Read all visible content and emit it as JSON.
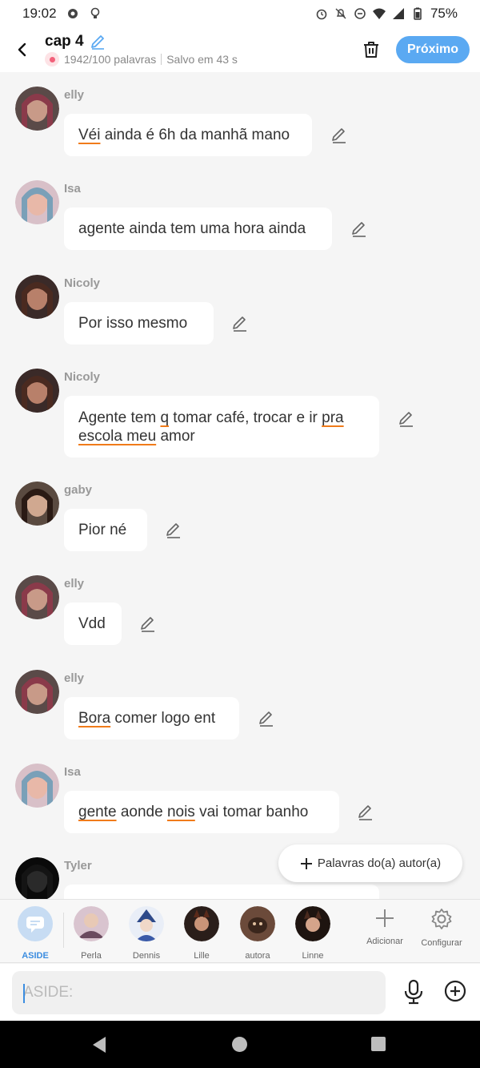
{
  "status": {
    "time": "19:02",
    "battery": "75%"
  },
  "header": {
    "title": "cap 4",
    "word_count": "1942/100 palavras",
    "saved": "Salvo em 43 s",
    "next_label": "Próximo"
  },
  "messages": [
    {
      "name": "elly",
      "text_parts": [
        [
          "Véi",
          true
        ],
        [
          " ainda é 6h da manhã mano",
          false
        ]
      ]
    },
    {
      "name": "Isa",
      "text_parts": [
        [
          "agente ainda tem uma hora ainda",
          false
        ]
      ]
    },
    {
      "name": "Nicoly",
      "text_parts": [
        [
          "Por isso mesmo",
          false
        ]
      ]
    },
    {
      "name": "Nicoly",
      "text_parts": [
        [
          "Agente tem ",
          false
        ],
        [
          "q",
          true
        ],
        [
          " tomar café, trocar e ir ",
          false
        ],
        [
          "pra",
          true
        ],
        [
          "\n",
          false
        ],
        [
          "escola meu",
          true
        ],
        [
          " amor",
          false
        ]
      ]
    },
    {
      "name": "gaby",
      "text_parts": [
        [
          "Pior né",
          false
        ]
      ]
    },
    {
      "name": "elly",
      "text_parts": [
        [
          "Vdd",
          false
        ]
      ]
    },
    {
      "name": "elly",
      "text_parts": [
        [
          "Bora",
          true
        ],
        [
          " comer logo ent",
          false
        ]
      ]
    },
    {
      "name": "Isa",
      "text_parts": [
        [
          "gente",
          true
        ],
        [
          " aonde ",
          false
        ],
        [
          "nois",
          true
        ],
        [
          " vai tomar banho",
          false
        ]
      ]
    },
    {
      "name": "Tyler",
      "text_parts": []
    }
  ],
  "floating_button": {
    "label": "Palavras do(a) autor(a)"
  },
  "characters": [
    {
      "label": "ASIDE",
      "selected": true
    },
    {
      "label": "Perla"
    },
    {
      "label": "Dennis"
    },
    {
      "label": "Lille"
    },
    {
      "label": "autora"
    },
    {
      "label": "Linne"
    }
  ],
  "tools": {
    "add_label": "Adicionar",
    "config_label": "Configurar"
  },
  "input": {
    "placeholder": "ASIDE:"
  },
  "colors": {
    "accent": "#5aa9f2",
    "underline": "#f07b1a",
    "aside": "#3c8de0"
  }
}
